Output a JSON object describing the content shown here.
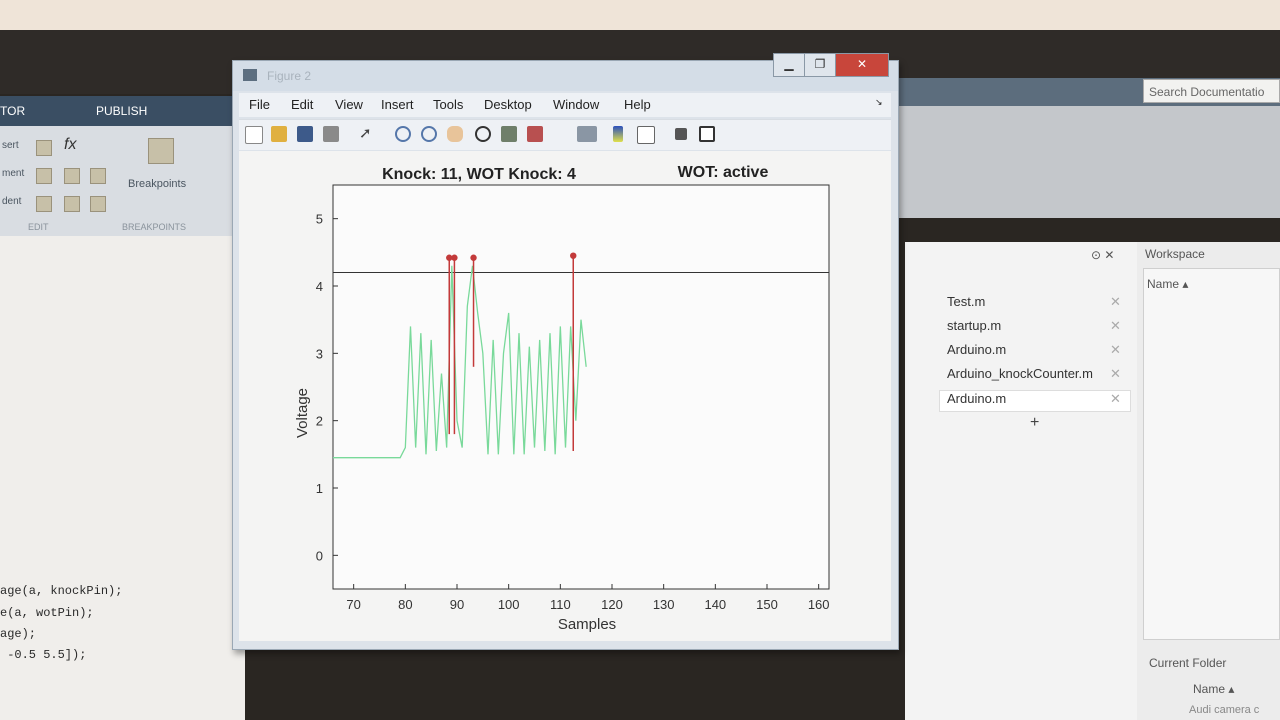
{
  "ribbon": {
    "tabs": [
      "TOR",
      "PUBLISH"
    ],
    "left_labels": [
      "sert",
      "ment",
      "dent"
    ],
    "fx_label": "fx",
    "breakpoints_label": "Breakpoints",
    "group_edit": "EDIT",
    "group_breakpoints": "BREAKPOINTS"
  },
  "code_lines": [
    "age(a, knockPin);",
    "e(a, wotPin);",
    "age);",
    " -0.5 5.5]);"
  ],
  "search": {
    "placeholder": "Search Documentatio"
  },
  "open_files": [
    "Test.m",
    "startup.m",
    "Arduino.m",
    "Arduino_knockCounter.m",
    "Arduino.m"
  ],
  "workspace": {
    "title": "Workspace",
    "name_col": "Name ▴"
  },
  "current_folder": {
    "title": "Current Folder",
    "name_col": "Name ▴",
    "item": "Audi camera c"
  },
  "figure": {
    "window_title": "Figure 2",
    "menus": [
      "File",
      "Edit",
      "View",
      "Insert",
      "Tools",
      "Desktop",
      "Window",
      "Help"
    ],
    "icons": [
      "new-figure-icon",
      "open-file-icon",
      "save-icon",
      "print-icon",
      "select-arrow-icon",
      "zoom-in-icon",
      "zoom-out-icon",
      "pan-hand-icon",
      "rotate-3d-icon",
      "data-cursor-icon",
      "brush-icon",
      "link-plot-icon",
      "colorbar-icon",
      "legend-icon",
      "hide-tools-icon",
      "show-tools-icon"
    ]
  },
  "chart_data": {
    "type": "line",
    "title_left": "Knock: 11, WOT Knock: 4",
    "title_right": "WOT: active",
    "xlabel": "Samples",
    "ylabel": "Voltage",
    "xlim": [
      66,
      162
    ],
    "ylim": [
      -0.5,
      5.5
    ],
    "xticks": [
      70,
      80,
      90,
      100,
      110,
      120,
      130,
      140,
      150,
      160
    ],
    "yticks": [
      0,
      1,
      2,
      3,
      4,
      5
    ],
    "threshold": 4.2,
    "signal": {
      "color": "#79d99a",
      "x": [
        66,
        79,
        80,
        81,
        82,
        83,
        84,
        85,
        86,
        87,
        88,
        89,
        90,
        91,
        92,
        93,
        94,
        95,
        96,
        97,
        98,
        99,
        100,
        101,
        102,
        103,
        104,
        105,
        106,
        107,
        108,
        109,
        110,
        111,
        112,
        113,
        114,
        115
      ],
      "y": [
        1.45,
        1.45,
        1.6,
        3.4,
        1.6,
        3.3,
        1.5,
        3.2,
        1.55,
        2.7,
        1.6,
        4.3,
        2.0,
        1.6,
        3.7,
        4.3,
        3.6,
        3.0,
        1.5,
        3.2,
        1.5,
        3.0,
        3.6,
        1.5,
        3.3,
        1.5,
        3.1,
        1.6,
        3.2,
        1.55,
        3.3,
        1.5,
        3.4,
        1.6,
        3.4,
        2.0,
        3.5,
        2.8
      ]
    },
    "knock_events": {
      "color": "#c33a3a",
      "x": [
        88.5,
        89.5,
        93.2,
        112.5
      ],
      "y": [
        4.42,
        4.42,
        4.42,
        4.45
      ],
      "base": [
        1.8,
        1.8,
        2.8,
        1.55
      ]
    }
  }
}
